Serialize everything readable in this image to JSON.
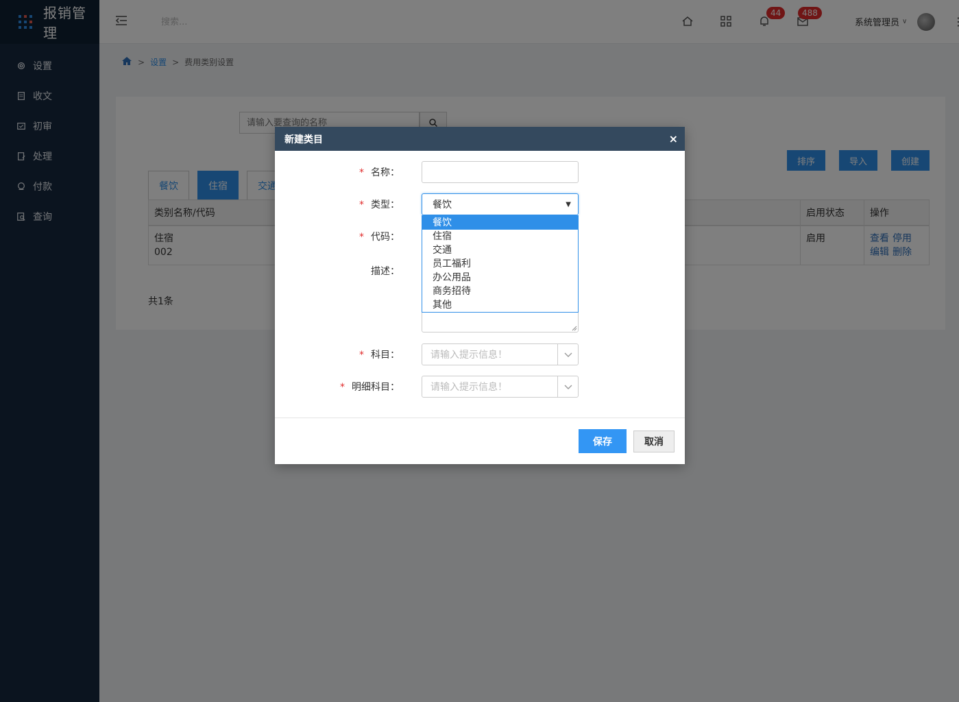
{
  "app": {
    "title": "报销管理"
  },
  "sidebar": {
    "items": [
      {
        "label": "设置",
        "icon": "gear-icon"
      },
      {
        "label": "收文",
        "icon": "document-icon"
      },
      {
        "label": "初审",
        "icon": "review-icon"
      },
      {
        "label": "处理",
        "icon": "edit-document-icon"
      },
      {
        "label": "付款",
        "icon": "payment-icon"
      },
      {
        "label": "查询",
        "icon": "search-document-icon"
      }
    ]
  },
  "topbar": {
    "search_placeholder": "搜索...",
    "notifications_count": "44",
    "messages_count": "488",
    "user_name": "系统管理员"
  },
  "breadcrumb": {
    "level1": "设置",
    "separator": ">",
    "current": "费用类别设置"
  },
  "page": {
    "query_placeholder": "请输入要查询的名称",
    "buttons": {
      "sort": "排序",
      "import": "导入",
      "create": "创建"
    },
    "tabs": [
      "餐饮",
      "住宿",
      "交通"
    ],
    "table": {
      "headers": {
        "name_code": "类别名称/代码",
        "status": "启用状态",
        "actions": "操作"
      },
      "rows": [
        {
          "name": "住宿",
          "code": "002",
          "status": "启用",
          "view": "查看",
          "disable": "停用",
          "edit": "编辑",
          "delete": "删除"
        }
      ]
    },
    "total": "共1条"
  },
  "modal": {
    "title": "新建类目",
    "close": "×",
    "fields": {
      "name_label": "名称：",
      "type_label": "类型：",
      "code_label": "代码：",
      "desc_label": "描述：",
      "subject_label": "科目：",
      "detail_subject_label": "明细科目：",
      "required_mark": "*",
      "type_value": "餐饮",
      "subject_placeholder": "请输入提示信息！",
      "detail_subject_placeholder": "请输入提示信息！"
    },
    "type_options": [
      "餐饮",
      "住宿",
      "交通",
      "员工福利",
      "办公用品",
      "商务招待",
      "其他"
    ],
    "buttons": {
      "save": "保存",
      "cancel": "取消"
    }
  },
  "colors": {
    "accent": "#2f8fe8",
    "sidebar_bg": "#16283e",
    "modal_header": "#34495e",
    "badge": "#e02a2a"
  }
}
